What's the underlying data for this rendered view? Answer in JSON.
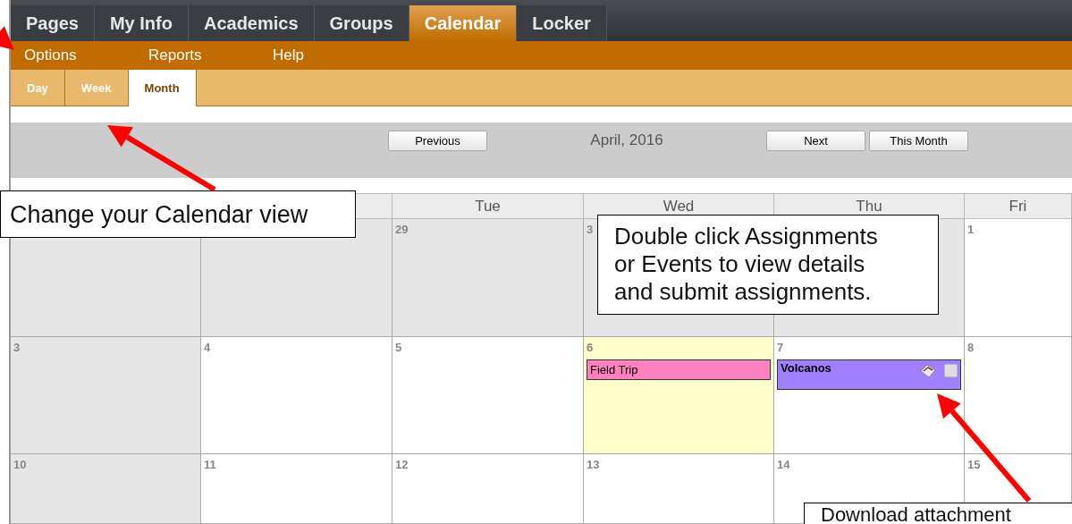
{
  "top_tabs": [
    {
      "label": "Pages",
      "selected": false
    },
    {
      "label": "My Info",
      "selected": false
    },
    {
      "label": "Academics",
      "selected": false
    },
    {
      "label": "Groups",
      "selected": false
    },
    {
      "label": "Calendar",
      "selected": true
    },
    {
      "label": "Locker",
      "selected": false
    }
  ],
  "menu": [
    "Options",
    "Reports",
    "Help"
  ],
  "view_tabs": [
    {
      "label": "Day",
      "selected": false
    },
    {
      "label": "Week",
      "selected": false
    },
    {
      "label": "Month",
      "selected": true
    }
  ],
  "navigation": {
    "previous": "Previous",
    "title": "April, 2016",
    "next": "Next",
    "this_month": "This Month"
  },
  "calendar": {
    "weekdays": [
      "Tue",
      "Wed",
      "Thu",
      "Fri"
    ],
    "weeks": [
      [
        {
          "shaded": true,
          "today": false
        },
        {
          "shaded": true,
          "today": false
        },
        {
          "date": "29",
          "shaded": true,
          "today": false
        },
        {
          "date": "3",
          "shaded": true,
          "today": false
        },
        {
          "shaded": true,
          "today": false
        },
        {
          "date": "1",
          "shaded": false,
          "today": false
        }
      ],
      [
        {
          "date": "3",
          "shaded": true,
          "today": false
        },
        {
          "date": "4",
          "shaded": false,
          "today": false
        },
        {
          "date": "5",
          "shaded": false,
          "today": false
        },
        {
          "date": "6",
          "shaded": false,
          "today": true,
          "events": [
            {
              "kind": "event",
              "title": "Field Trip",
              "color": "#ff80bf"
            }
          ]
        },
        {
          "date": "7",
          "shaded": false,
          "today": false,
          "events": [
            {
              "kind": "assignment",
              "title": "Volcanos",
              "color": "#a080ff",
              "checked": false
            }
          ]
        },
        {
          "date": "8",
          "shaded": false,
          "today": false
        }
      ],
      [
        {
          "date": "10",
          "shaded": true,
          "today": false
        },
        {
          "date": "11",
          "shaded": false,
          "today": false
        },
        {
          "date": "12",
          "shaded": false,
          "today": false
        },
        {
          "date": "13",
          "shaded": false,
          "today": false
        },
        {
          "date": "14",
          "shaded": false,
          "today": false
        },
        {
          "date": "15",
          "shaded": false,
          "today": false
        }
      ]
    ]
  },
  "callouts": [
    "Change your Calendar view",
    "Double click Assignments or Events to view details and submit assignments.",
    "Download attachment"
  ]
}
